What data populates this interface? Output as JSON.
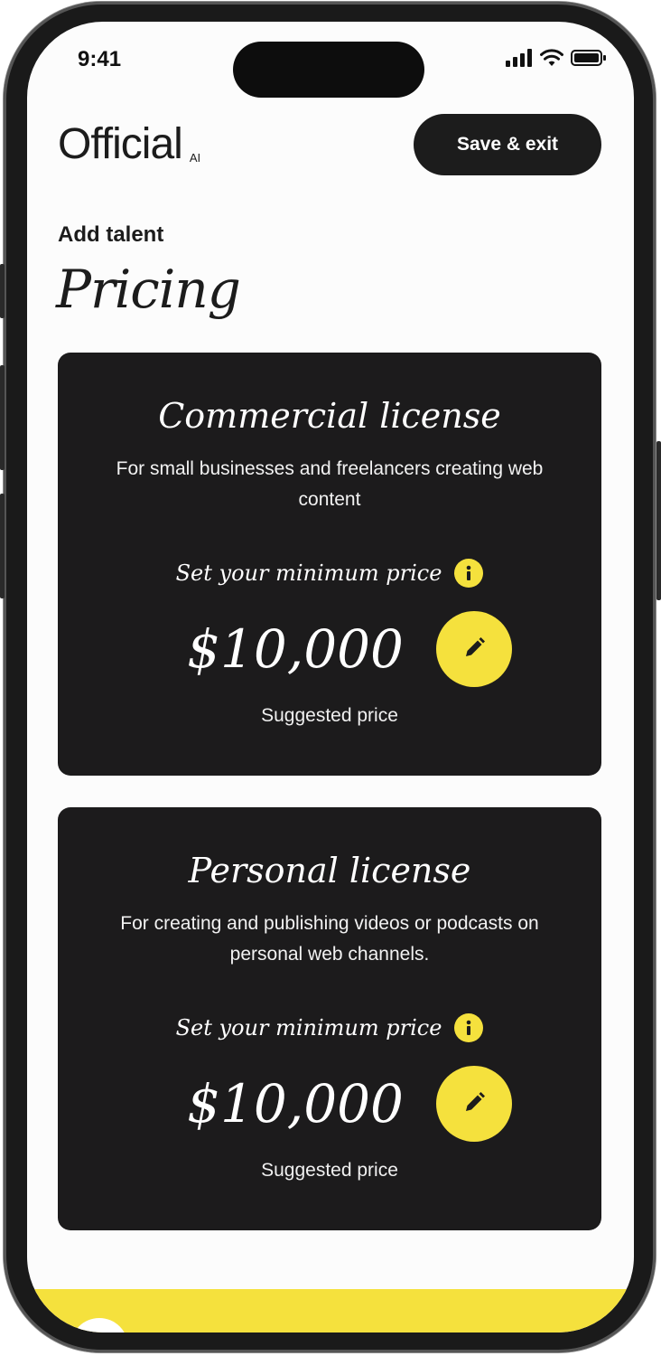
{
  "status_bar": {
    "time": "9:41"
  },
  "header": {
    "logo_text": "Official",
    "logo_suffix": "AI",
    "save_exit_label": "Save & exit"
  },
  "page": {
    "eyebrow": "Add talent",
    "title": "Pricing"
  },
  "licenses": [
    {
      "title": "Commercial license",
      "description": "For small businesses and freelancers creating web content",
      "min_price_label": "Set your minimum price",
      "price": "$10,000",
      "price_note": "Suggested price"
    },
    {
      "title": "Personal license",
      "description": "For creating and publishing videos or podcasts on personal web channels.",
      "min_price_label": "Set your minimum price",
      "price": "$10,000",
      "price_note": "Suggested price"
    }
  ],
  "colors": {
    "accent": "#f5e13d",
    "card_bg": "#1c1b1c",
    "text_dark": "#1c1c1c"
  },
  "icons": {
    "info": "info-icon",
    "edit": "pencil-icon",
    "signal": "cellular-signal-icon",
    "wifi": "wifi-icon",
    "battery": "battery-icon"
  }
}
